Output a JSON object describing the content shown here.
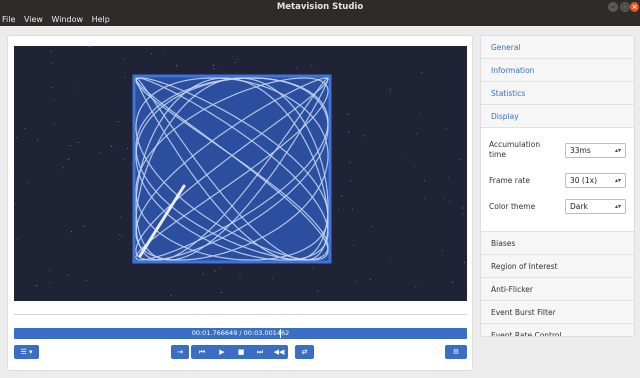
{
  "window": {
    "title": "Metavision Studio"
  },
  "menu": [
    "File",
    "View",
    "Window",
    "Help"
  ],
  "player": {
    "time_display": "00:01.766649 / 00:03.001462",
    "progress": 0.588
  },
  "controls": {
    "list_icon": "list-icon",
    "export_icon": "export-icon",
    "skip_back_icon": "skip-back-icon",
    "play_icon": "play-icon",
    "stop_icon": "stop-icon",
    "skip_forward_icon": "skip-forward-icon",
    "rewind_icon": "rewind-icon",
    "loop_icon": "loop-icon",
    "settings_icon": "settings-icon"
  },
  "sidebar": {
    "top_sections": [
      "General",
      "Information",
      "Statistics",
      "Display"
    ],
    "display": {
      "accumulation_label": "Accumulation time",
      "accumulation_value": "33ms",
      "frame_rate_label": "Frame rate",
      "frame_rate_value": "30 (1x)",
      "color_theme_label": "Color theme",
      "color_theme_value": "Dark"
    },
    "bottom_sections": [
      "Biases",
      "Region of Interest",
      "Anti-Flicker",
      "Event Burst Filter",
      "Event Rate Control"
    ]
  },
  "colors": {
    "accent": "#3a6dc4",
    "video_bg": "#1f2335",
    "event_color": "#3e73d8"
  }
}
